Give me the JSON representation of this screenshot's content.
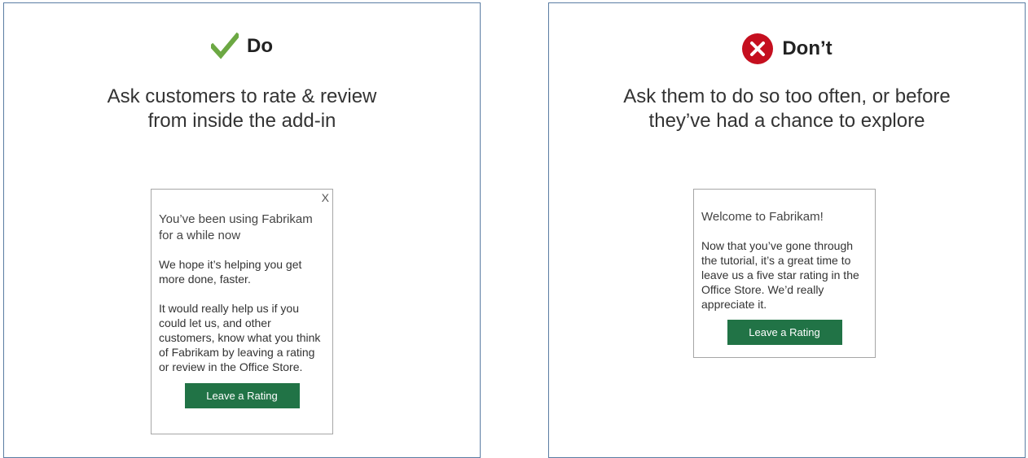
{
  "do_panel": {
    "verdict": "Do",
    "verdict_icon": "checkmark-icon",
    "verdict_color": "#6ca843",
    "headline_line1": "Ask customers to rate & review",
    "headline_line2": "from inside the add-in",
    "dialog": {
      "close_label": "X",
      "title": "You’ve been using Fabrikam for a while now",
      "paragraph1": "We hope it’s helping you get more done, faster.",
      "paragraph2": "It would really help us if you could let us, and other customers, know what you think of Fabrikam by leaving a rating or review in the Office Store.",
      "button_label": "Leave a Rating",
      "button_color": "#217346"
    }
  },
  "dont_panel": {
    "verdict": "Don’t",
    "verdict_icon": "error-x-icon",
    "verdict_color": "#c50f1f",
    "headline_line1": "Ask them to do so too often, or before",
    "headline_line2": "they’ve had a chance to explore",
    "dialog": {
      "title": "Welcome to Fabrikam!",
      "paragraph1": "Now that you’ve gone through the tutorial, it’s a great time to leave us a five star rating in the Office Store. We’d really appreciate it.",
      "button_label": "Leave a Rating",
      "button_color": "#217346"
    }
  }
}
